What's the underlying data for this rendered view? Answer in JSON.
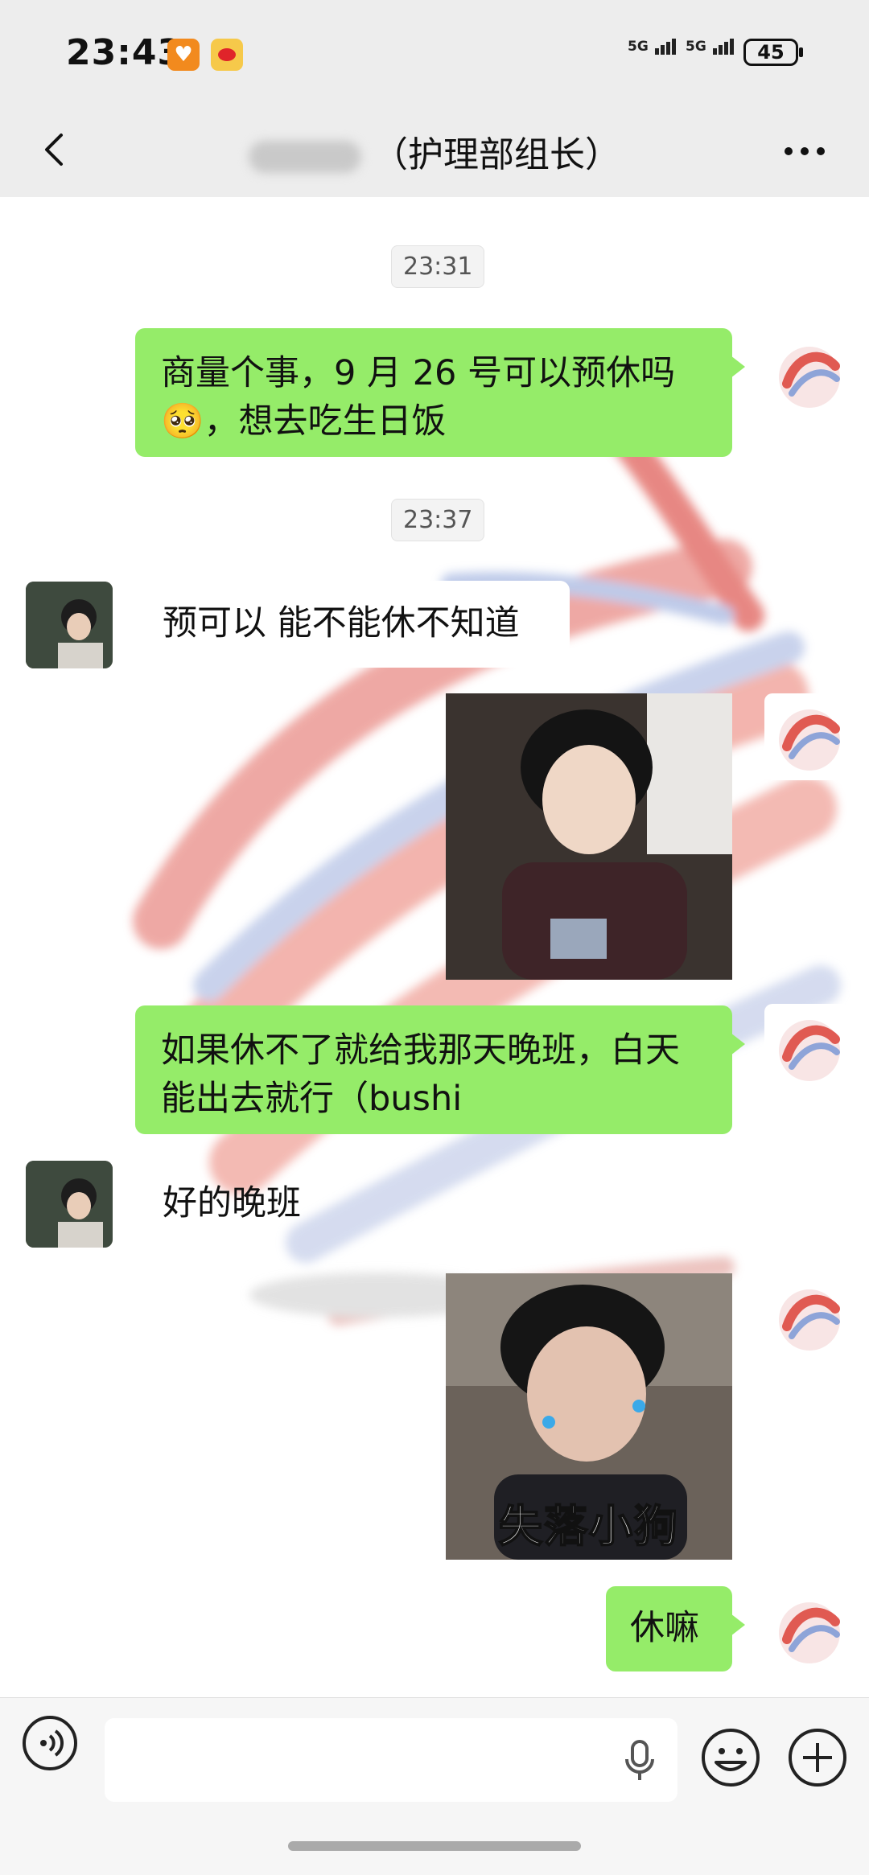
{
  "status_bar": {
    "time": "23:43",
    "signal_1": "5G",
    "signal_2": "5G",
    "battery": "45",
    "icons": [
      "heart-app-icon",
      "weibo-app-icon",
      "signal-icon",
      "battery-icon"
    ]
  },
  "nav": {
    "title": "（护理部组长）",
    "icons": [
      "back-icon",
      "more-icon"
    ]
  },
  "chat": {
    "timestamps": [
      "23:31",
      "23:37"
    ],
    "messages": [
      {
        "side": "right",
        "type": "text",
        "text_line1": "商量个事，9 月 26 号可以预休吗",
        "text_line2": "🥺，想去吃生日饭"
      },
      {
        "side": "left",
        "type": "text",
        "text": "预可以 能不能休不知道"
      },
      {
        "side": "right",
        "type": "image",
        "description_icon": "photo-sticker"
      },
      {
        "side": "right",
        "type": "text",
        "text_line1": "如果休不了就给我那天晚班，白天",
        "text_line2": "能出去就行（bushi"
      },
      {
        "side": "left",
        "type": "text",
        "text": "好的晚班"
      },
      {
        "side": "right",
        "type": "image",
        "caption": "失落小狗"
      },
      {
        "side": "right",
        "type": "text",
        "text": "休嘛"
      }
    ]
  },
  "input_bar": {
    "placeholder": "",
    "icons": [
      "voice-icon",
      "microphone-icon",
      "emoji-icon",
      "plus-icon"
    ]
  },
  "colors": {
    "bubble_self": "#95ec69",
    "bubble_peer": "#ffffff",
    "background": "#ededed"
  }
}
